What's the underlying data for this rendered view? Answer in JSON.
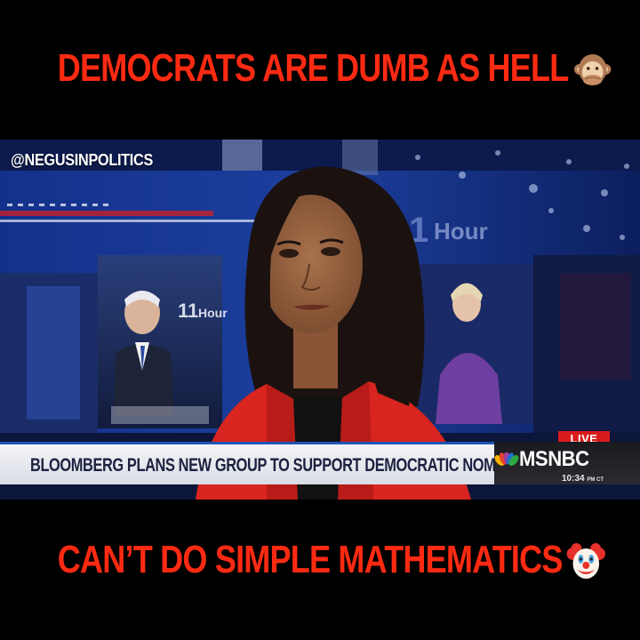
{
  "captions": {
    "top": "DEMOCRATS ARE DUMB AS HELL",
    "top_emoji": "see-no-evil-monkey-emoji",
    "bottom": "CAN’T DO SIMPLE MATHEMATICS",
    "bottom_emoji": "clown-face-emoji"
  },
  "watermark": {
    "handle": "@NEGUSINPOLITICS"
  },
  "broadcast": {
    "headline": "BLOOMBERG PLANS NEW GROUP TO SUPPORT DEMOCRATIC NOMINEE",
    "live_label": "LIVE",
    "network": "MSNBC",
    "time": "10:34",
    "time_suffix": "PM CT",
    "background_logo": "11th Hour"
  },
  "colors": {
    "caption": "#ff2a12",
    "background": "#000000",
    "live_red": "#d81b1b",
    "studio_blue": "#1c3f9e"
  }
}
